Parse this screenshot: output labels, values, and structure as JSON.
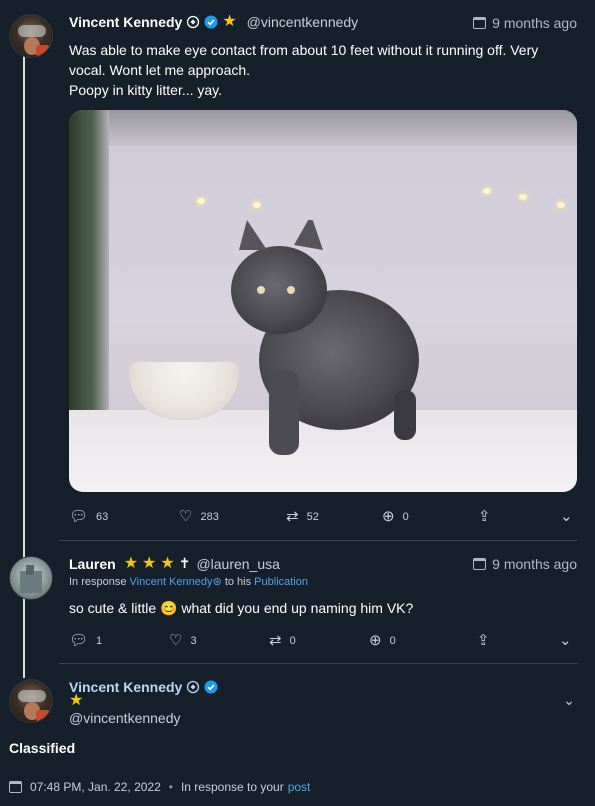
{
  "tweet": {
    "author_name": "Vincent Kennedy",
    "handle": "@vincentkennedy",
    "time": "9 months ago",
    "text": "Was able to make eye contact from about 10 feet without it running off. Very vocal. Wont let me approach.\nPoopy in kitty litter... yay.",
    "actions": {
      "replies": "63",
      "likes": "283",
      "retweets": "52",
      "quotes": "0"
    }
  },
  "reply": {
    "author_name": "Lauren",
    "handle": "@lauren_usa",
    "time": "9 months ago",
    "in_response_prefix": "In response",
    "in_response_name": "Vincent Kennedy",
    "in_response_mid": "to his",
    "in_response_link": "Publication",
    "text": "so cute & little 😊 what did you end up naming him VK?",
    "actions": {
      "replies": "1",
      "likes": "3",
      "retweets": "0",
      "quotes": "0"
    }
  },
  "main": {
    "author_name": "Vincent Kennedy",
    "handle": "@vincentkennedy",
    "text": "Classified",
    "timestamp": "07:48 PM, Jan. 22, 2022",
    "in_response_text": "In response to your",
    "in_response_link": "post"
  },
  "colors": {
    "background": "#15202b",
    "link": "#4fa3e8",
    "star": "#f5c518",
    "verified": "#1d9bf0"
  }
}
